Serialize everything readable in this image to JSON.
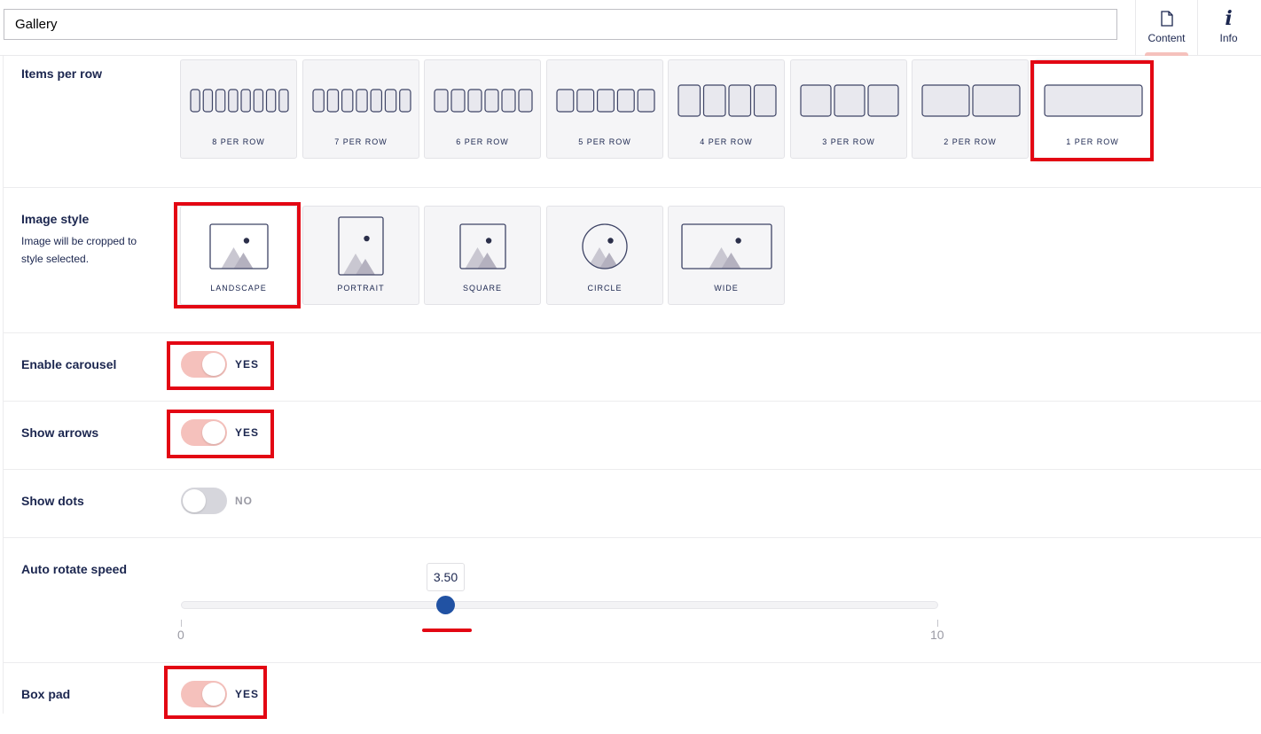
{
  "header": {
    "name_value": "Gallery",
    "apps": [
      {
        "label": "Content",
        "icon": "document-icon",
        "active": true
      },
      {
        "label": "Info",
        "icon": "info-icon",
        "active": false
      }
    ]
  },
  "items_per_row": {
    "label": "Items per row",
    "options": [
      {
        "label": "8 PER ROW",
        "count": 8
      },
      {
        "label": "7 PER ROW",
        "count": 7
      },
      {
        "label": "6 PER ROW",
        "count": 6
      },
      {
        "label": "5 PER ROW",
        "count": 5
      },
      {
        "label": "4 PER ROW",
        "count": 4
      },
      {
        "label": "3 PER ROW",
        "count": 3
      },
      {
        "label": "2 PER ROW",
        "count": 2
      },
      {
        "label": "1 PER ROW",
        "count": 1
      }
    ],
    "selected": "1 PER ROW"
  },
  "image_style": {
    "label": "Image style",
    "description": "Image will be cropped to style selected.",
    "options": [
      {
        "label": "LANDSCAPE",
        "shape": "landscape"
      },
      {
        "label": "PORTRAIT",
        "shape": "portrait"
      },
      {
        "label": "SQUARE",
        "shape": "square"
      },
      {
        "label": "CIRCLE",
        "shape": "circle"
      },
      {
        "label": "WIDE",
        "shape": "wide"
      }
    ],
    "selected": "LANDSCAPE"
  },
  "enable_carousel": {
    "label": "Enable carousel",
    "state": "YES"
  },
  "show_arrows": {
    "label": "Show arrows",
    "state": "YES"
  },
  "show_dots": {
    "label": "Show dots",
    "state": "NO"
  },
  "auto_rotate_speed": {
    "label": "Auto rotate speed",
    "value": 3.5,
    "value_label": "3.50",
    "min": 0,
    "max": 10,
    "min_label": "0",
    "max_label": "10"
  },
  "box_pad": {
    "label": "Box pad",
    "state": "YES"
  },
  "colors": {
    "accent": "#f5c1bc",
    "slider": "#2152a3",
    "highlight": "#e30613",
    "text": "#1b264f"
  }
}
